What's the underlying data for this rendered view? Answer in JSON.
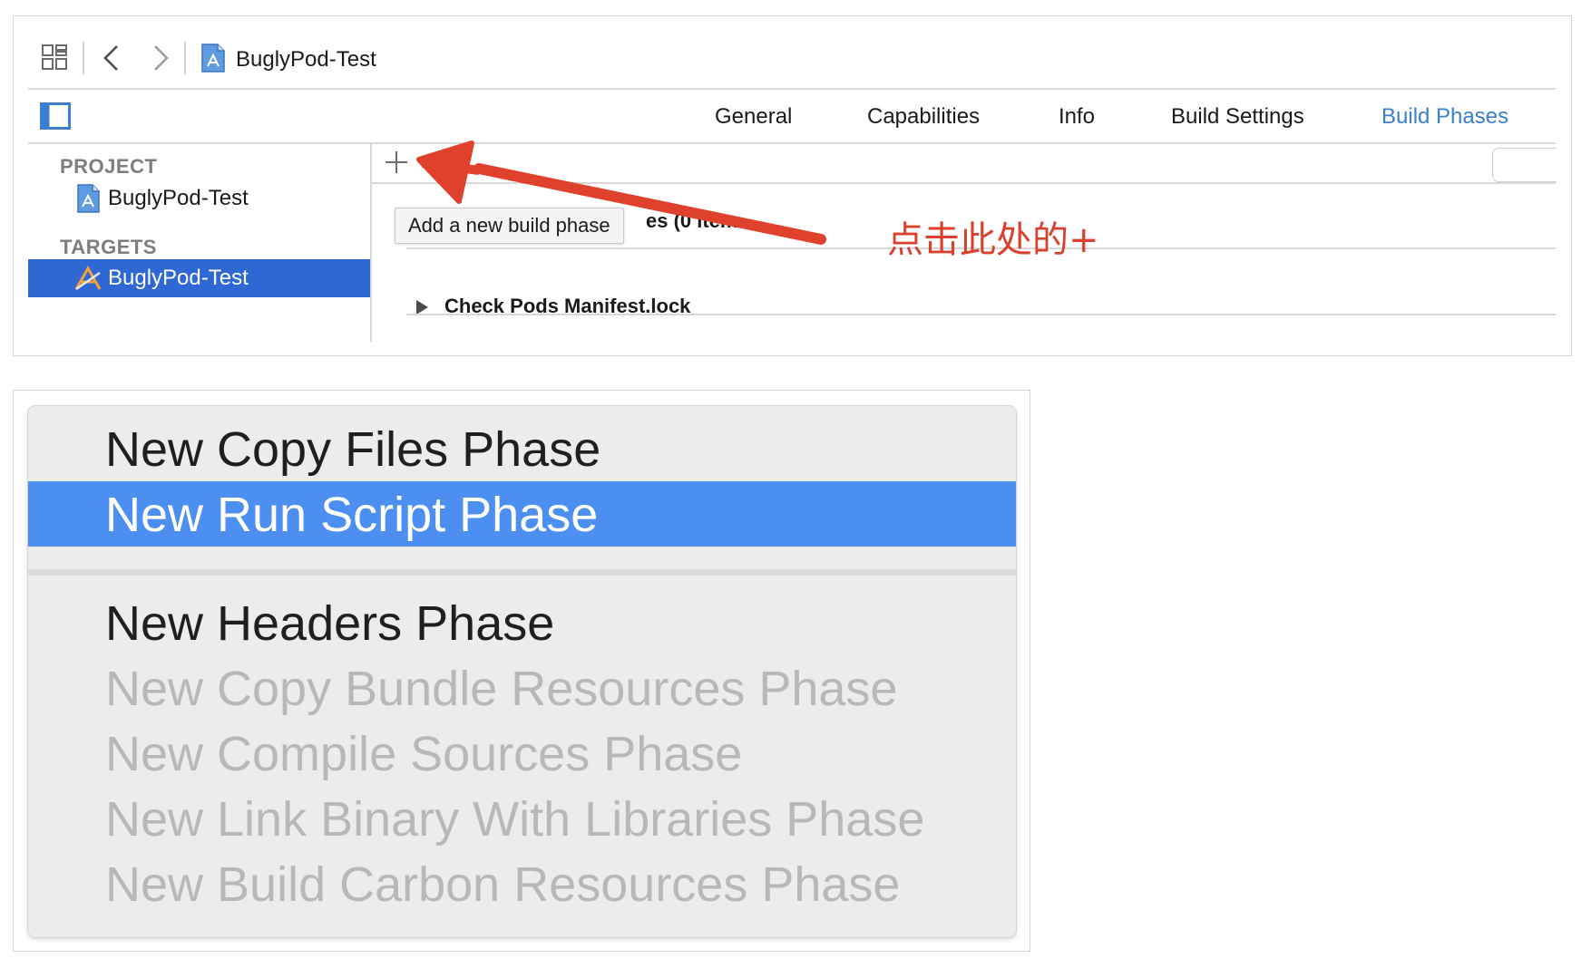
{
  "toolbar": {
    "breadcrumb": "BuglyPod-Test"
  },
  "tabs": [
    {
      "label": "General",
      "active": false
    },
    {
      "label": "Capabilities",
      "active": false
    },
    {
      "label": "Info",
      "active": false
    },
    {
      "label": "Build Settings",
      "active": false
    },
    {
      "label": "Build Phases",
      "active": true
    }
  ],
  "sidebar": {
    "project_header": "PROJECT",
    "project_item": "BuglyPod-Test",
    "targets_header": "TARGETS",
    "target_item": "BuglyPod-Test"
  },
  "main": {
    "tooltip": "Add a new build phase",
    "partial_phase_title": "es (0 items)",
    "phase_row": "Check Pods Manifest.lock"
  },
  "annotation": {
    "text": "点击此处的+",
    "color": "#d9412e"
  },
  "menu": {
    "items": [
      {
        "label": "New Copy Files Phase",
        "state": "enabled"
      },
      {
        "label": "New Run Script Phase",
        "state": "highlighted"
      },
      {
        "label": "New Headers Phase",
        "state": "enabled"
      },
      {
        "label": "New Copy Bundle Resources Phase",
        "state": "disabled"
      },
      {
        "label": "New Compile Sources Phase",
        "state": "disabled"
      },
      {
        "label": "New Link Binary With Libraries Phase",
        "state": "disabled"
      },
      {
        "label": "New Build Carbon Resources Phase",
        "state": "disabled"
      }
    ]
  },
  "colors": {
    "accent": "#3a7fd0",
    "selection": "#2f67d4",
    "menu_highlight": "#4c8ff0"
  }
}
